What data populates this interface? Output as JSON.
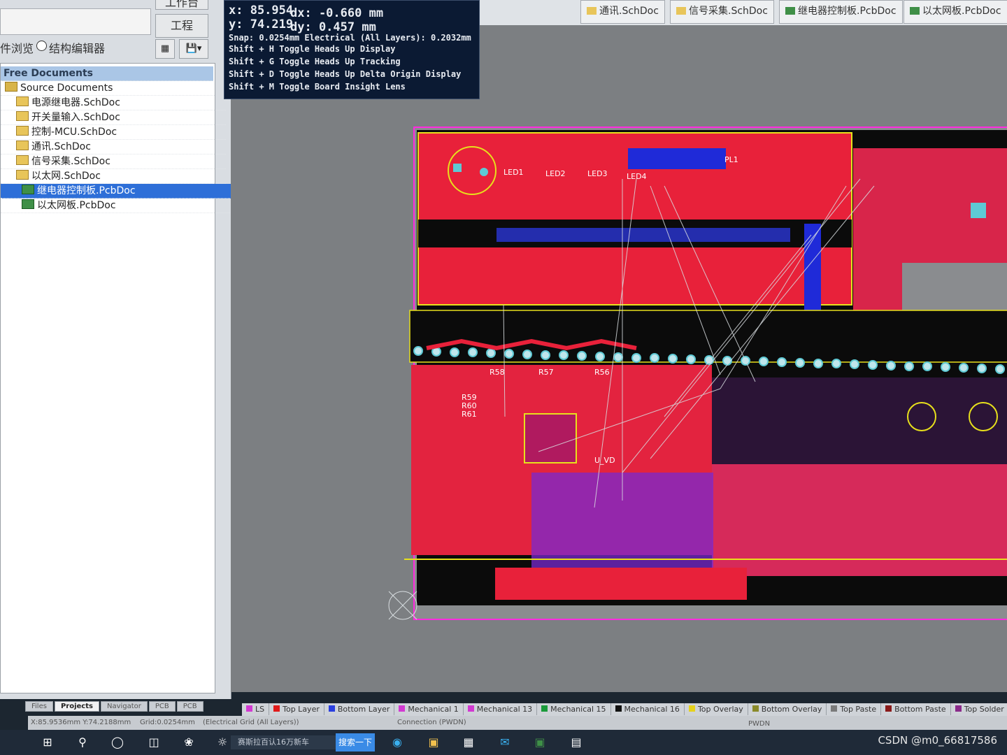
{
  "left_panel": {
    "workspace_button": "工作台",
    "project_button": "工程",
    "view_prefix": "件浏览",
    "structure_editor": "结构编辑器",
    "tree": [
      {
        "label": "Free Documents",
        "kind": "header"
      },
      {
        "label": "Source Documents",
        "kind": "folder"
      },
      {
        "label": "电源继电器.SchDoc",
        "kind": "sch"
      },
      {
        "label": "开关量输入.SchDoc",
        "kind": "sch"
      },
      {
        "label": "控制-MCU.SchDoc",
        "kind": "sch"
      },
      {
        "label": "通讯.SchDoc",
        "kind": "sch"
      },
      {
        "label": "信号采集.SchDoc",
        "kind": "sch"
      },
      {
        "label": "以太网.SchDoc",
        "kind": "sch"
      },
      {
        "label": "继电器控制板.PcbDoc",
        "kind": "pcb",
        "selected": true
      },
      {
        "label": "以太网板.PcbDoc",
        "kind": "pcb"
      }
    ],
    "tabs": [
      "Files",
      "Projects",
      "Navigator",
      "PCB",
      "PCB"
    ]
  },
  "doc_tabs": [
    {
      "label": "通讯.SchDoc",
      "icon": "sch-icon"
    },
    {
      "label": "信号采集.SchDoc",
      "icon": "sch-icon"
    },
    {
      "label": "继电器控制板.PcbDoc",
      "icon": "pcb-icon"
    },
    {
      "label": "以太网板.PcbDoc",
      "icon": "pcb-icon"
    }
  ],
  "heads_up": {
    "x": "x: 85.954",
    "dx": "dx: -0.660 mm",
    "y": "y: 74.219",
    "dy": "dy:  0.457  mm",
    "snap": "Snap: 0.0254mm Electrical (All Layers): 0.2032mm",
    "hotkeys": [
      "Shift + H  Toggle Heads Up Display",
      "Shift + G  Toggle Heads Up Tracking",
      "Shift + D  Toggle Heads Up Delta Origin Display",
      "Shift + M  Toggle Board Insight Lens"
    ]
  },
  "board_labels": [
    "LED1",
    "LED2",
    "LED3",
    "LED4",
    "PL1",
    "U_VD",
    "R56",
    "R57",
    "R58",
    "R59",
    "R60",
    "R61"
  ],
  "layers": [
    {
      "label": "LS",
      "color": "#d23ad2"
    },
    {
      "label": "Top Layer",
      "color": "#e01a1a"
    },
    {
      "label": "Bottom Layer",
      "color": "#2a3fe0"
    },
    {
      "label": "Mechanical 1",
      "color": "#d23ad2"
    },
    {
      "label": "Mechanical 13",
      "color": "#d23ad2"
    },
    {
      "label": "Mechanical 15",
      "color": "#1a9a3a"
    },
    {
      "label": "Mechanical 16",
      "color": "#111111"
    },
    {
      "label": "Top Overlay",
      "color": "#e6d21c"
    },
    {
      "label": "Bottom Overlay",
      "color": "#8a8a2a"
    },
    {
      "label": "Top Paste",
      "color": "#7a7a7a"
    },
    {
      "label": "Bottom Paste",
      "color": "#8a1a1a"
    },
    {
      "label": "Top Solder",
      "color": "#8a2a8a"
    }
  ],
  "status": {
    "coords": "X:85.9536mm Y:74.2188mm",
    "grid": "Grid:0.0254mm",
    "electrical": "(Electrical Grid (All Layers))",
    "connection": "Connection (PWDN)",
    "pwdn": "PWDN"
  },
  "taskbar": {
    "search_text": "赛斯拉百认16万新车",
    "search_button": "搜索一下",
    "watermark": "CSDN @m0_66817586"
  }
}
